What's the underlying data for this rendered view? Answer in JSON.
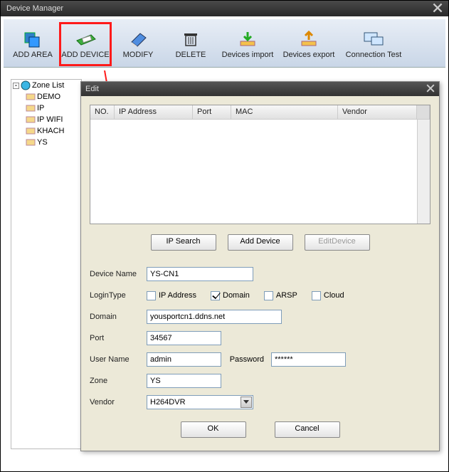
{
  "outer": {
    "title": "Device Manager"
  },
  "toolbar": {
    "add_area": "ADD AREA",
    "add_device": "ADD DEVICE",
    "modify": "MODIFY",
    "delete": "DELETE",
    "import": "Devices import",
    "export": "Devices export",
    "conn_test": "Connection Test"
  },
  "tree": {
    "root": "Zone List",
    "items": [
      "DEMO",
      "IP",
      "IP WIFI",
      "KHACH",
      "YS"
    ]
  },
  "edit": {
    "title": "Edit",
    "columns": {
      "no": "NO.",
      "ip": "IP Address",
      "port": "Port",
      "mac": "MAC",
      "vendor": "Vendor"
    },
    "buttons": {
      "ip_search": "IP Search",
      "add_device": "Add Device",
      "edit_device": "EditDevice",
      "ok": "OK",
      "cancel": "Cancel"
    },
    "labels": {
      "device_name": "Device Name",
      "login_type": "LoginType",
      "ip_address": "IP Address",
      "domain_opt": "Domain",
      "arsp": "ARSP",
      "cloud": "Cloud",
      "domain": "Domain",
      "port": "Port",
      "user_name": "User Name",
      "password": "Password",
      "zone": "Zone",
      "vendor": "Vendor"
    },
    "values": {
      "device_name": "YS-CN1",
      "domain": "yousportcn1.ddns.net",
      "port": "34567",
      "user_name": "admin",
      "password": "******",
      "zone": "YS",
      "vendor": "H264DVR"
    }
  }
}
